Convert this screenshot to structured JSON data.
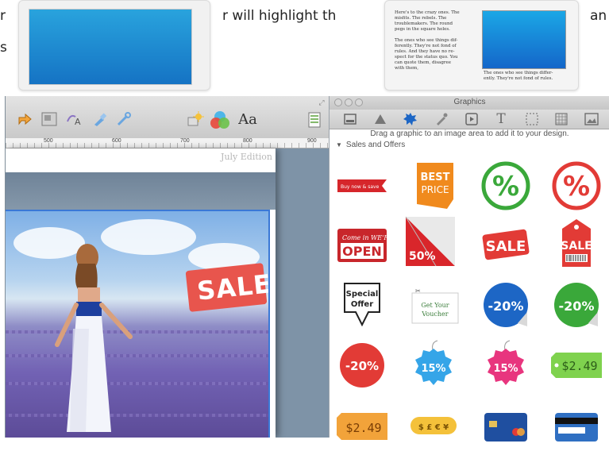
{
  "tutorial": {
    "text_left": "r",
    "text_mid": "r will highlight th",
    "text_right": "an",
    "text_s": "s",
    "thumb_text_col1": [
      "Here's to the crazy ones. The",
      "misfits. The rebels. The",
      "troublemakers. The round",
      "pegs in the square holes.",
      "",
      "The ones who see things dif-",
      "ferently. They're not fond of",
      "rules. And they have no re-",
      "spect for the status quo. You",
      "can quote them, disagree",
      "with them,"
    ],
    "thumb_text_col2": [
      "The ones who see things differ-",
      "ently. They're not fond of rules."
    ]
  },
  "doc_window": {
    "ruler_labels": [
      "500",
      "600",
      "700",
      "800",
      "900"
    ],
    "edition_text": "July Edition",
    "toolbar_icons": [
      "share-icon",
      "layout-icon",
      "text-style-icon",
      "brush-icon",
      "tools-icon",
      "sparkle-icon",
      "colors-icon",
      "fonts-icon",
      "list-icon"
    ],
    "fonts_label": "Aa",
    "photo_sale_text": "SALE"
  },
  "graphics_panel": {
    "title": "Graphics",
    "hint": "Drag a graphic to an image area to add it to your design.",
    "section": "Sales and Offers",
    "category_icons": [
      "frame-icon",
      "shape-icon",
      "badge-icon",
      "pen-icon",
      "media-icon",
      "text-icon",
      "selection-icon",
      "pattern-icon",
      "image-icon"
    ],
    "items": [
      {
        "name": "buy-now-ribbon",
        "label": "Buy now & save"
      },
      {
        "name": "best-price-tag",
        "label": "BEST PRICE"
      },
      {
        "name": "percent-green-stamp",
        "label": "%"
      },
      {
        "name": "percent-red-stamp",
        "label": "%"
      },
      {
        "name": "come-in-open-sign",
        "label": "OPEN",
        "sub": "Come in WE'RE"
      },
      {
        "name": "fifty-percent-corner",
        "label": "50%"
      },
      {
        "name": "sale-sticker",
        "label": "SALE"
      },
      {
        "name": "sale-hang-tag",
        "label": "SALE"
      },
      {
        "name": "special-offer-sign",
        "label": "Special Offer"
      },
      {
        "name": "get-your-voucher",
        "label": "Get Your Voucher"
      },
      {
        "name": "minus-20-blue",
        "label": "-20%"
      },
      {
        "name": "minus-20-green",
        "label": "-20%"
      },
      {
        "name": "minus-20-red",
        "label": "-20%"
      },
      {
        "name": "fifteen-blue-tag",
        "label": "15%"
      },
      {
        "name": "fifteen-pink-tag",
        "label": "15%"
      },
      {
        "name": "price-249-green",
        "label": "$2.49"
      },
      {
        "name": "price-249-orange",
        "label": "$2.49"
      },
      {
        "name": "coins-tag",
        "label": "$ £ € ¥"
      },
      {
        "name": "credit-card-blue",
        "label": ""
      },
      {
        "name": "credit-card-back",
        "label": ""
      }
    ],
    "colors": {
      "red": "#e23b36",
      "green": "#3aa83a",
      "blue": "#1d66c5",
      "orange": "#f08a1d",
      "pink": "#e8357e"
    }
  }
}
